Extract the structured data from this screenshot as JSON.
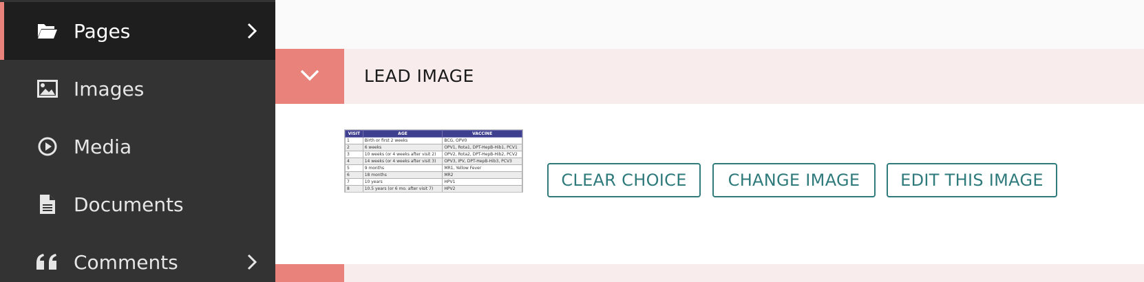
{
  "sidebar": {
    "items": [
      {
        "label": "Pages",
        "icon": "folder-open-icon",
        "active": true,
        "has_submenu": true
      },
      {
        "label": "Images",
        "icon": "image-icon",
        "active": false,
        "has_submenu": false
      },
      {
        "label": "Media",
        "icon": "play-circle-icon",
        "active": false,
        "has_submenu": false
      },
      {
        "label": "Documents",
        "icon": "document-icon",
        "active": false,
        "has_submenu": false
      },
      {
        "label": "Comments",
        "icon": "quote-icon",
        "active": false,
        "has_submenu": true
      }
    ]
  },
  "panel": {
    "title": "LEAD IMAGE",
    "toggle_icon": "chevron-down-icon",
    "thumbnail": {
      "headers": [
        "VISIT",
        "AGE",
        "VACCINE"
      ],
      "rows": [
        [
          "1",
          "Birth or first 2 weeks",
          "BCG, OPV0"
        ],
        [
          "2",
          "6 weeks",
          "OPV1, Rota1, DPT-HepB-Hib1, PCV1"
        ],
        [
          "3",
          "10 weeks (or 4 weeks after visit 2)",
          "OPV2, Rota2, DPT-HepB-Hib2, PCV2"
        ],
        [
          "4",
          "14 weeks (or 4 weeks after visit 3)",
          "OPV3, IPV, DPT-HepB-Hib3, PCV3"
        ],
        [
          "5",
          "9 months",
          "MR1, Yellow Fever"
        ],
        [
          "6",
          "18 months",
          "MR2"
        ],
        [
          "7",
          "10 years",
          "HPV1"
        ],
        [
          "8",
          "10.5 years (or 6 mo. after visit 7)",
          "HPV2"
        ]
      ]
    },
    "buttons": {
      "clear": "CLEAR CHOICE",
      "change": "CHANGE IMAGE",
      "edit": "EDIT THIS IMAGE"
    }
  },
  "colors": {
    "sidebar_bg": "#333333",
    "sidebar_active_bg": "#1e1e1e",
    "accent": "#e9827b",
    "header_bg": "#f9eced",
    "button_teal": "#2f7a7b"
  }
}
